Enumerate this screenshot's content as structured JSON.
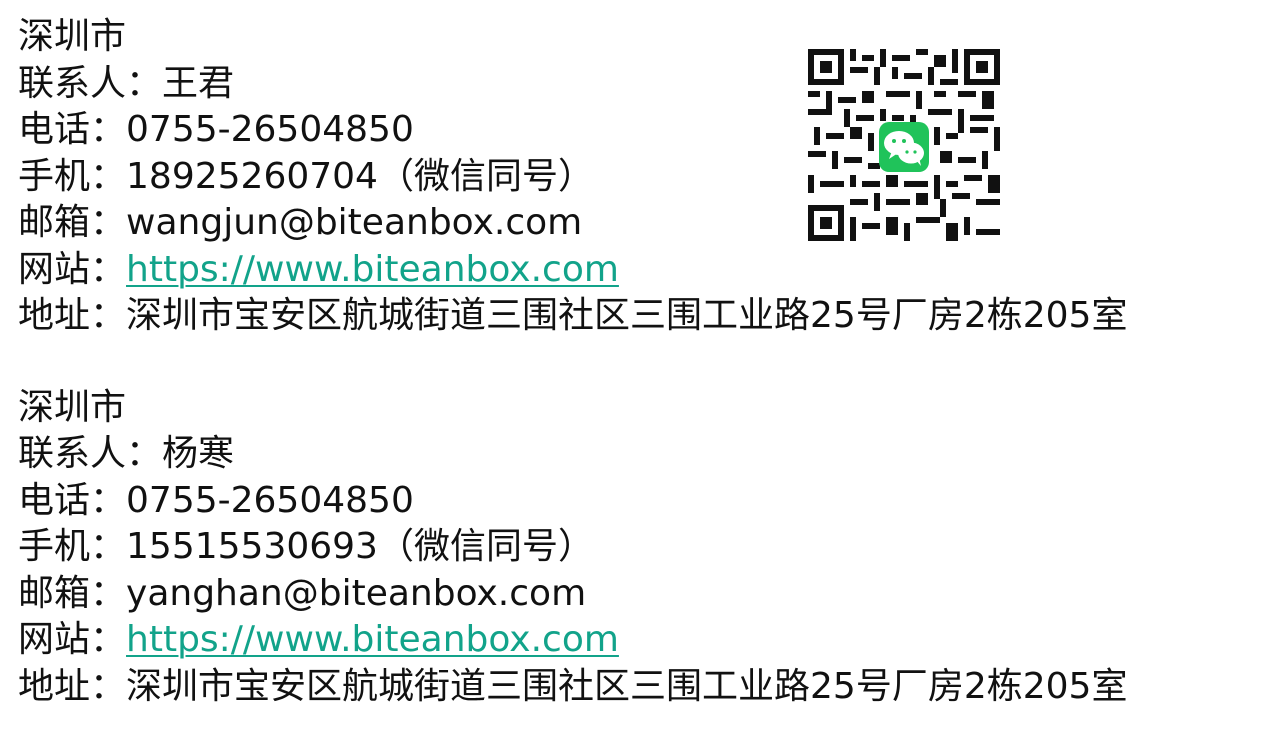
{
  "contacts": [
    {
      "city": "深圳市",
      "contact_label": "联系人：",
      "contact_name": "王君",
      "phone_label": "电话：",
      "phone_value": "0755-26504850",
      "mobile_label": "手机：",
      "mobile_value": "18925260704",
      "mobile_note": "（微信同号）",
      "email_label": "邮箱：",
      "email_value": "wangjun@biteanbox.com",
      "website_label": "网站：",
      "website_value": "https://www.biteanbox.com",
      "address_label": "地址：",
      "address_value": "深圳市宝安区航城街道三围社区三围工业路25号厂房2栋205室"
    },
    {
      "city": "深圳市",
      "contact_label": "联系人：",
      "contact_name": "杨寒",
      "phone_label": "电话：",
      "phone_value": "0755-26504850",
      "mobile_label": "手机：",
      "mobile_value": "15515530693",
      "mobile_note": "（微信同号）",
      "email_label": "邮箱：",
      "email_value": "yanghan@biteanbox.com",
      "website_label": "网站：",
      "website_value": "https://www.biteanbox.com",
      "address_label": "地址：",
      "address_value": "深圳市宝安区航城街道三围社区三围工业路25号厂房2栋205室"
    }
  ],
  "qr_code": {
    "icon": "wechat-qr-code-icon",
    "accent_color": "#20c35a"
  },
  "colors": {
    "text": "#111111",
    "link": "#12a38a",
    "background": "#ffffff"
  }
}
